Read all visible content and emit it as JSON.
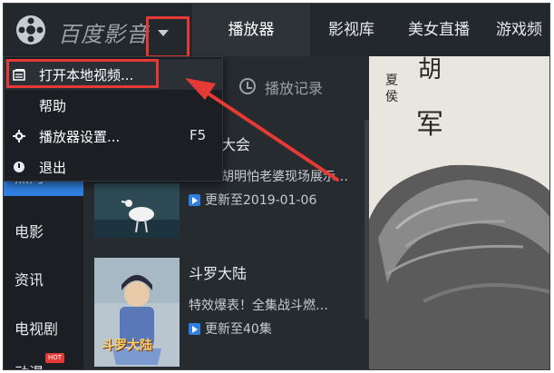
{
  "app": {
    "title": "百度影音"
  },
  "nav": {
    "tabs": [
      "播放器",
      "影视库",
      "美女直播",
      "游戏频"
    ]
  },
  "dropdown_menu": {
    "items": [
      {
        "label": "打开本地视频...",
        "shortcut": "",
        "icon": "open-file-icon"
      },
      {
        "label": "帮助",
        "shortcut": "",
        "icon": ""
      },
      {
        "label": "播放器设置...",
        "shortcut": "F5",
        "icon": "gear-icon"
      },
      {
        "label": "退出",
        "shortcut": "",
        "icon": "power-icon"
      }
    ]
  },
  "sidebar": {
    "items": [
      "热门",
      "电影",
      "资讯",
      "电视剧",
      "动漫"
    ],
    "badge": "HOT"
  },
  "list_header": {
    "history_label": "播放记录"
  },
  "list": {
    "items": [
      {
        "title_fragment": "大会",
        "description": "胡明怕老婆现场展示…",
        "update": "更新至2019-01-06"
      },
      {
        "title": "斗罗大陆",
        "description": "特效爆表！全集战斗燃…",
        "update": "更新至40集",
        "thumb_caption": "斗罗大陆"
      }
    ]
  },
  "poster": {
    "char_top": "胡",
    "sub_chars": "夏侯",
    "char_main": "军"
  },
  "colors": {
    "accent": "#2f7fe0",
    "annotation_red": "#e53935",
    "dark_bg": "#1f2429"
  }
}
